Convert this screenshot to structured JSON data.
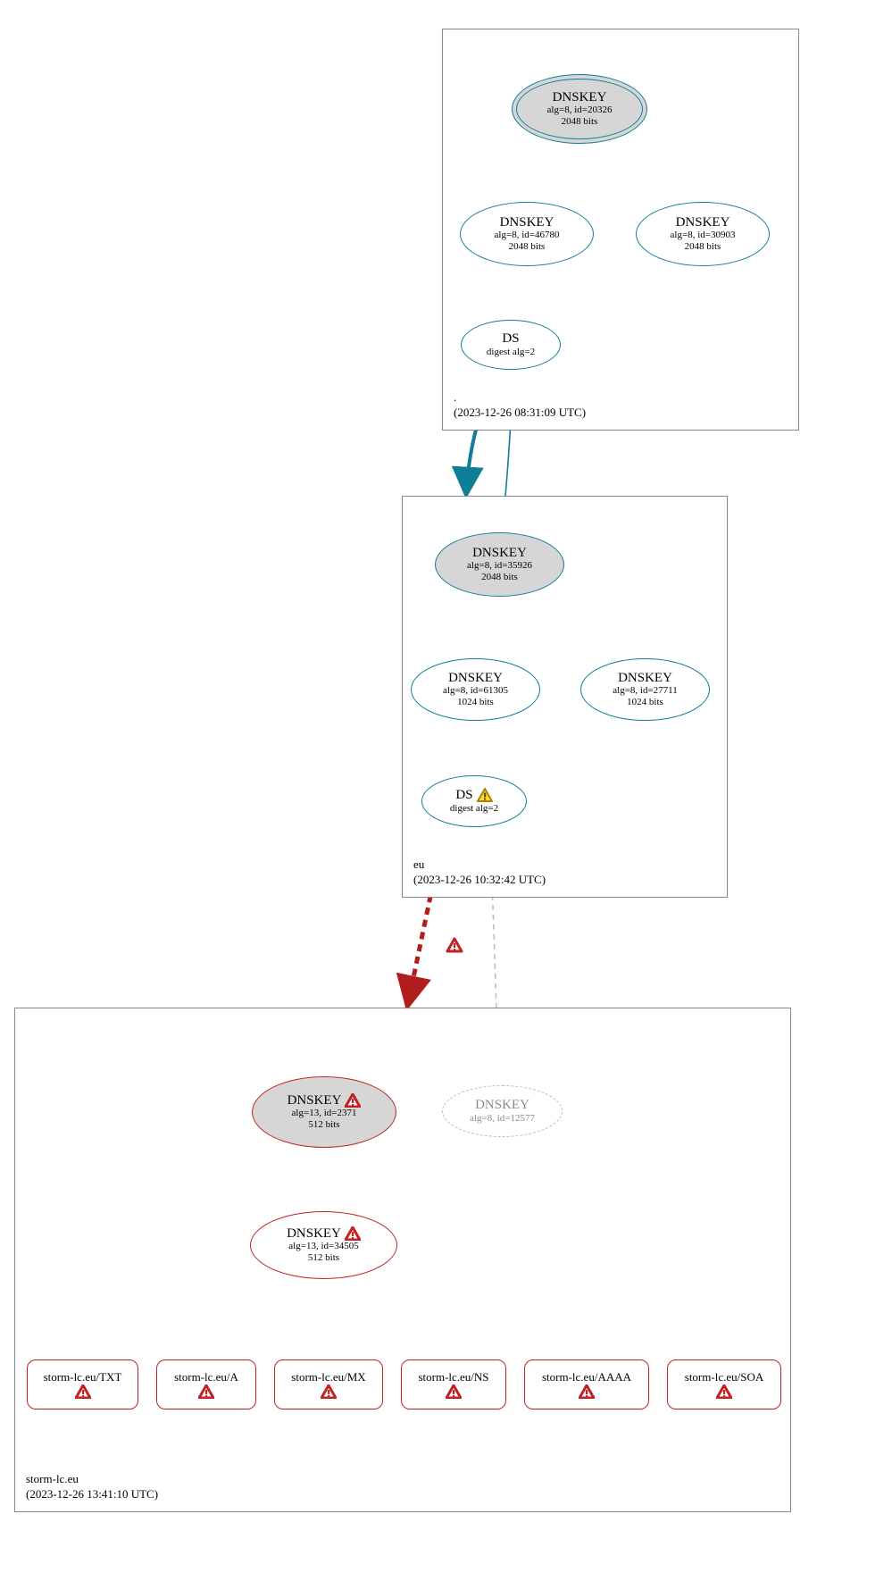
{
  "zones": {
    "root": {
      "name": ".",
      "timestamp": "(2023-12-26 08:31:09 UTC)"
    },
    "eu": {
      "name": "eu",
      "timestamp": "(2023-12-26 10:32:42 UTC)"
    },
    "storm": {
      "name": "storm-lc.eu",
      "timestamp": "(2023-12-26 13:41:10 UTC)"
    }
  },
  "nodes": {
    "root_ksk": {
      "title": "DNSKEY",
      "l1": "alg=8, id=20326",
      "l2": "2048 bits"
    },
    "root_zsk1": {
      "title": "DNSKEY",
      "l1": "alg=8, id=46780",
      "l2": "2048 bits"
    },
    "root_zsk2": {
      "title": "DNSKEY",
      "l1": "alg=8, id=30903",
      "l2": "2048 bits"
    },
    "root_ds": {
      "title": "DS",
      "l1": "digest alg=2",
      "l2": ""
    },
    "eu_ksk": {
      "title": "DNSKEY",
      "l1": "alg=8, id=35926",
      "l2": "2048 bits"
    },
    "eu_zsk1": {
      "title": "DNSKEY",
      "l1": "alg=8, id=61305",
      "l2": "1024 bits"
    },
    "eu_zsk2": {
      "title": "DNSKEY",
      "l1": "alg=8, id=27711",
      "l2": "1024 bits"
    },
    "eu_ds": {
      "title": "DS",
      "l1": "digest alg=2",
      "l2": ""
    },
    "storm_ksk": {
      "title": "DNSKEY",
      "l1": "alg=13, id=2371",
      "l2": "512 bits"
    },
    "storm_zsk": {
      "title": "DNSKEY",
      "l1": "alg=13, id=34505",
      "l2": "512 bits"
    },
    "storm_ghost": {
      "title": "DNSKEY",
      "l1": "alg=8, id=12577",
      "l2": ""
    }
  },
  "rrsets": {
    "txt": "storm-lc.eu/TXT",
    "a": "storm-lc.eu/A",
    "mx": "storm-lc.eu/MX",
    "ns": "storm-lc.eu/NS",
    "aaaa": "storm-lc.eu/AAAA",
    "soa": "storm-lc.eu/SOA"
  }
}
